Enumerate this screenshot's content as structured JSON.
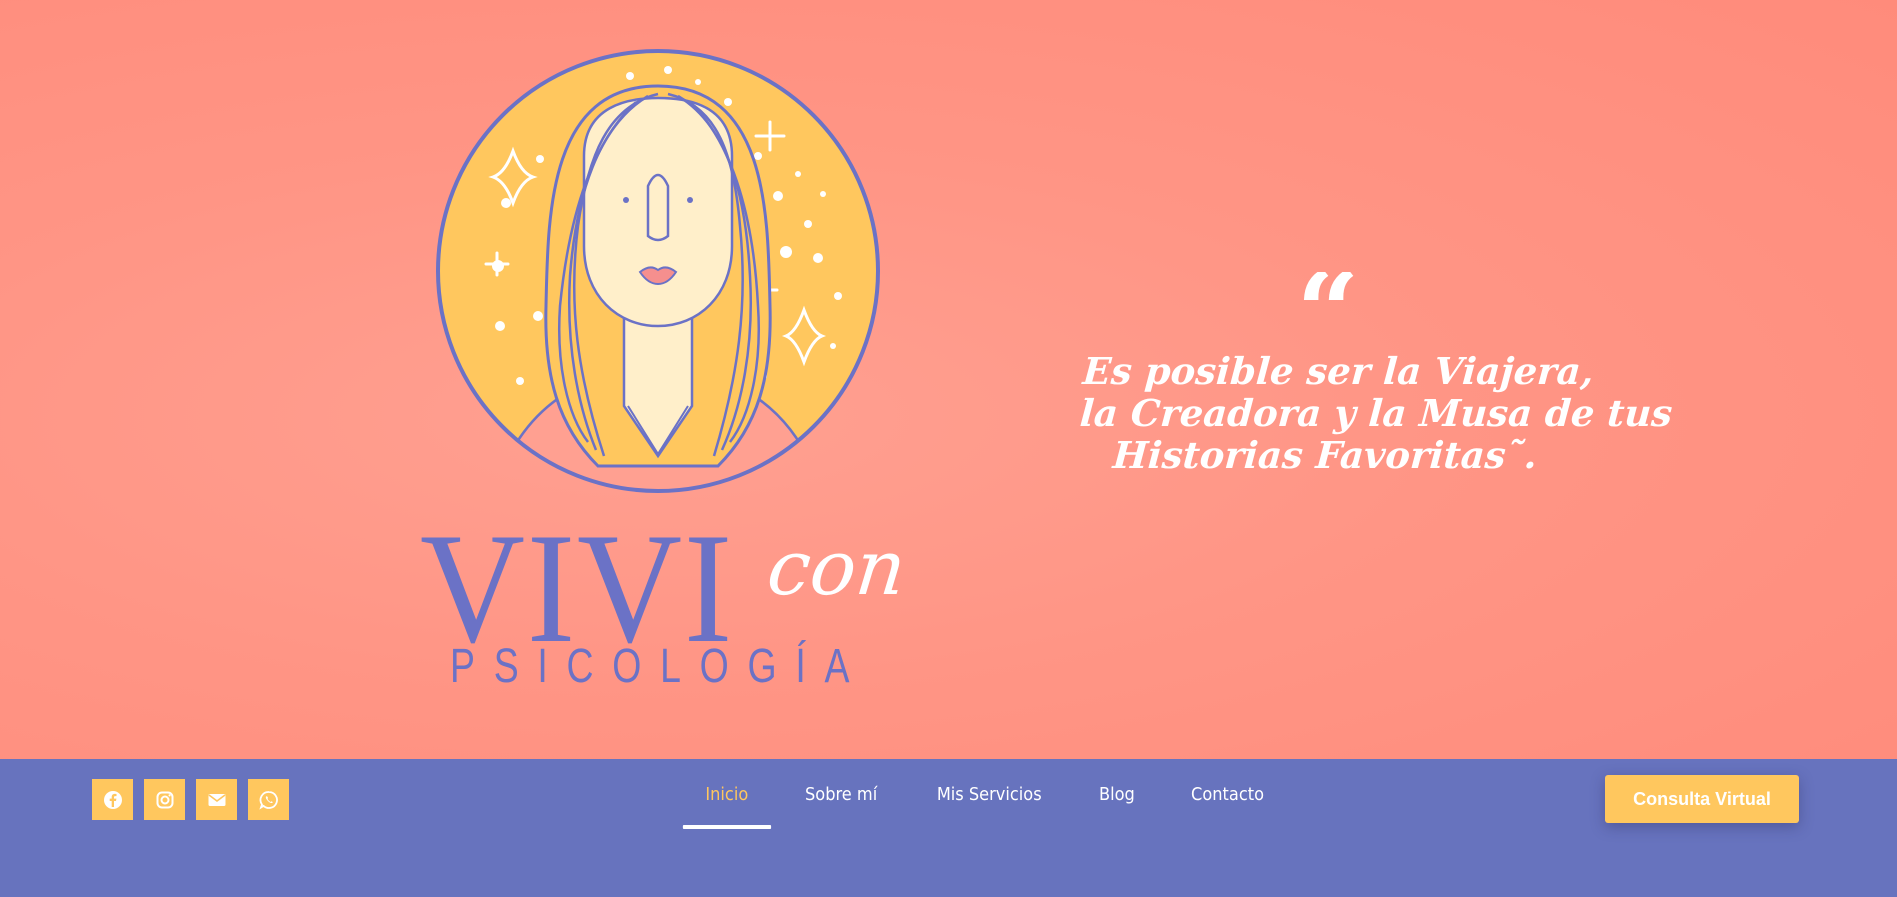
{
  "brand": {
    "name_main": "VIVI",
    "name_script": "con",
    "subtitle": "PSICOLOGÍA"
  },
  "quote": {
    "mark": "“",
    "lines": [
      "Es posible ser la Viajera,",
      "la Creadora y la Musa de tus",
      "Historias Favoritas˜."
    ]
  },
  "social": [
    {
      "icon": "facebook-icon"
    },
    {
      "icon": "instagram-icon"
    },
    {
      "icon": "email-icon"
    },
    {
      "icon": "whatsapp-icon"
    }
  ],
  "nav": {
    "items": [
      {
        "label": "Inicio",
        "active": true
      },
      {
        "label": "Sobre mí",
        "active": false
      },
      {
        "label": "Mis Servicios",
        "active": false
      },
      {
        "label": "Blog",
        "active": false
      },
      {
        "label": "Contacto",
        "active": false
      }
    ]
  },
  "cta": {
    "label": "Consulta Virtual"
  },
  "colors": {
    "hero_bg": "#ff9585",
    "nav_bg": "#6773be",
    "accent_yellow": "#ffc75e",
    "brand_blue": "#6b72c6"
  }
}
